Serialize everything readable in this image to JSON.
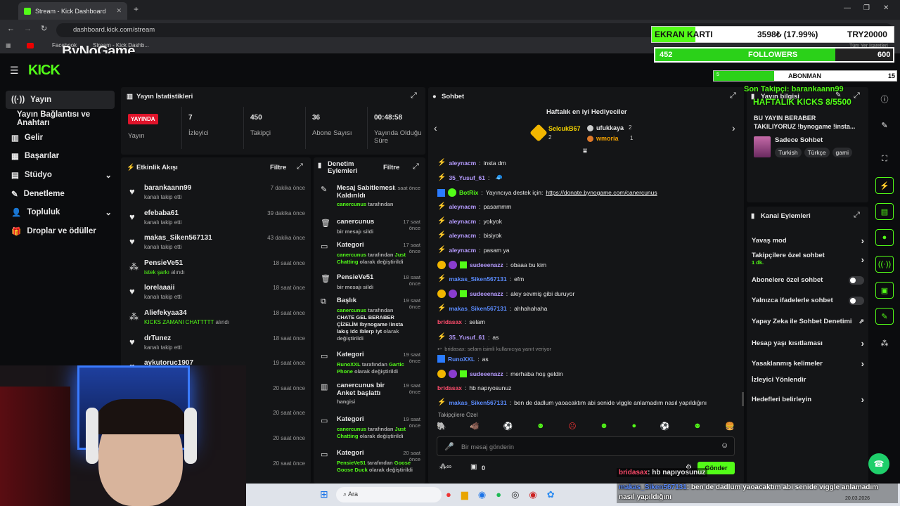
{
  "browser": {
    "tab_title": "Stream - Kick Dashboard",
    "url": "dashboard.kick.com/stream",
    "bookmarks": [
      "Facebook",
      "Stream - Kick Dashb..."
    ],
    "bookmarks_right": "Tüm Yer İşaretleri",
    "watermark": "ByNoGame"
  },
  "overlay": {
    "gpu_label": "EKRAN KARTI",
    "gpu_price": "3598₺ (17.99%)",
    "gpu_target": "TRY20000",
    "gpu_progress": 0.1799,
    "followers_current": "452",
    "followers_label": "FOLLOWERS",
    "followers_goal": "600",
    "followers_progress": 0.753,
    "subs_current": "5",
    "subs_label": "ABONMAN",
    "subs_goal": "15",
    "subs_progress": 0.333,
    "last_follower": "Son Takipçi: barankaann99",
    "weekly_kicks": "HAFTALIK KICKS 8/5500",
    "chat_overlay_1_user": "bridasax",
    "chat_overlay_1_msg": ": hb napıyosunuz",
    "chat_overlay_2_user": "makas_Siken567131",
    "chat_overlay_2_msg": ": ben de dadlum yaoacaktım abi senide viggle anlamadım nasıl yapıldığını"
  },
  "sidebar": {
    "items": [
      {
        "label": "Yayın",
        "icon": "broadcast-icon"
      },
      {
        "label": "Yayın Bağlantısı ve Anahtarı",
        "icon": ""
      },
      {
        "label": "Gelir",
        "icon": "revenue-icon"
      },
      {
        "label": "Başarılar",
        "icon": "achievements-icon"
      },
      {
        "label": "Stüdyo",
        "icon": "studio-icon"
      },
      {
        "label": "Denetleme",
        "icon": "wrench-icon"
      },
      {
        "label": "Topluluk",
        "icon": "community-icon"
      },
      {
        "label": "Droplar ve ödüller",
        "icon": "gift-icon"
      }
    ]
  },
  "stats": {
    "title": "Yayın İstatistikleri",
    "live": "YAYINDA",
    "live_label": "Yayın",
    "items": [
      {
        "value": "7",
        "label": "İzleyici"
      },
      {
        "value": "450",
        "label": "Takipçi"
      },
      {
        "value": "36",
        "label": "Abone Sayısı"
      },
      {
        "value": "00:48:58",
        "label": "Yayında Olduğu Süre"
      }
    ]
  },
  "activity": {
    "title": "Etkinlik Akışı",
    "filter": "Filtre",
    "events": [
      {
        "name": "barankaann99",
        "sub": "kanalı takip etti",
        "time": "7 dakika önce",
        "icon": "heart"
      },
      {
        "name": "efebaba61",
        "sub": "kanalı takip etti",
        "time": "39 dakika önce",
        "icon": "heart"
      },
      {
        "name": "makas_Siken567131",
        "sub": "kanalı takip etti",
        "time": "43 dakika önce",
        "icon": "heart"
      },
      {
        "name": "PensieVe51",
        "sub": "istek şarkı",
        "sub2": " alındı",
        "time": "18 saat önce",
        "icon": "points"
      },
      {
        "name": "lorelaaaii",
        "sub": "kanalı takip etti",
        "time": "18 saat önce",
        "icon": "heart"
      },
      {
        "name": "Aliefekyaa34",
        "sub": "KICKS ZAMANI CHATTTTT",
        "sub2": " alındı",
        "time": "18 saat önce",
        "icon": "points"
      },
      {
        "name": "drTunez",
        "sub": "kanalı takip etti",
        "time": "18 saat önce",
        "icon": "heart"
      },
      {
        "name": "aykutoruc1907",
        "sub": "",
        "time": "19 saat önce",
        "icon": "heart"
      },
      {
        "name": "",
        "sub": "",
        "time": "20 saat önce",
        "icon": ""
      },
      {
        "name": "",
        "sub": "",
        "time": "20 saat önce",
        "icon": ""
      },
      {
        "name": "",
        "sub": "",
        "time": "20 saat önce",
        "icon": ""
      },
      {
        "name": "",
        "sub": "",
        "time": "20 saat önce",
        "icon": ""
      }
    ]
  },
  "moderation": {
    "title": "Denetim Eylemleri",
    "filter": "Filtre",
    "actions": [
      {
        "title": "Mesaj Sabitlemesi Kaldırıldı",
        "time": "1 saat önce",
        "by": "canercunus",
        "by_suffix": " tarafından"
      },
      {
        "title": "canercunus",
        "time": "17 saat önce",
        "desc": "bir mesajı sildi"
      },
      {
        "title": "Kategori",
        "time": "17 saat önce",
        "by": "canercunus",
        "by_suffix": " tarafından ",
        "hl": "Just Chatting",
        "desc": " olarak değiştirildi"
      },
      {
        "title": "PensieVe51",
        "time": "18 saat önce",
        "desc": "bir mesajı sildi"
      },
      {
        "title": "Başlık",
        "time": "19 saat önce",
        "by": "canercunus",
        "by_suffix": " tarafından",
        "body": "CHATE GEL BERABER ÇİZELİM !bynogame !insta lakış !dc !blerp !yt",
        "desc": " olarak değiştirildi"
      },
      {
        "title": "Kategori",
        "time": "19 saat önce",
        "by": "RunoXXL",
        "by_suffix": " tarafından ",
        "hl": "Gartic Phone",
        "desc": " olarak değiştirildi"
      },
      {
        "title": "canercunus bir Anket başlattı",
        "time": "19 saat önce",
        "desc": "hangisi"
      },
      {
        "title": "Kategori",
        "time": "19 saat önce",
        "by": "canercunus",
        "by_suffix": " tarafından ",
        "hl": "Just Chatting",
        "desc": " olarak değiştirildi"
      },
      {
        "title": "Kategori",
        "time": "20 saat önce",
        "by": "PensieVe51",
        "by_suffix": " tarafından ",
        "hl": "Goose Goose Duck",
        "desc": " olarak değiştirildi"
      }
    ]
  },
  "chat": {
    "title": "Sohbet",
    "gifters_title": "Haftalık en iyi Hediyeciler",
    "gifters": [
      {
        "name": "SelcukB67",
        "count": "2"
      },
      {
        "name": "ufukkaya",
        "count": "2"
      },
      {
        "name": "wmoria",
        "count": "1"
      }
    ],
    "messages": [
      {
        "user": "aleynacm",
        "text": "insta dm",
        "color": "#b69cff"
      },
      {
        "user": "35_Yusuf_61",
        "text": "",
        "color": "#b69cff"
      },
      {
        "user": "BotRix",
        "text": "Yayıncıya destek için: ",
        "link": "https://donate.bynogame.com/canercunus",
        "color": "#53fc18"
      },
      {
        "user": "aleynacm",
        "text": "pasammm",
        "color": "#b69cff"
      },
      {
        "user": "aleynacm",
        "text": "yokyok",
        "color": "#b69cff"
      },
      {
        "user": "aleynacm",
        "text": "bisiyok",
        "color": "#b69cff"
      },
      {
        "user": "aleynacm",
        "text": "pasam ya",
        "color": "#b69cff"
      },
      {
        "user": "sudeeenazz",
        "text": "obaaa bu kim",
        "color": "#b69cff"
      },
      {
        "user": "makas_Siken567131",
        "text": "efm",
        "color": "#5b8cff"
      },
      {
        "user": "sudeeenazz",
        "text": "aley sevmiş gibi duruyor",
        "color": "#b69cff"
      },
      {
        "user": "makas_Siken567131",
        "text": "ahhahahaha",
        "color": "#5b8cff"
      },
      {
        "user": "bridasax",
        "text": "selam",
        "color": "#ff4d6d"
      },
      {
        "user": "35_Yusuf_61",
        "text": "as",
        "color": "#b69cff"
      },
      {
        "user": "RunoXXL",
        "text": "as",
        "color": "#5b8cff",
        "reply": "bridasax: selam isimli kullanıcıya yanıt veriyor"
      },
      {
        "user": "sudeeenazz",
        "text": "merhaba hoş geldin",
        "color": "#b69cff"
      },
      {
        "user": "bridasax",
        "text": "hb napıyosunuz",
        "color": "#ff4d6d"
      },
      {
        "user": "makas_Siken567131",
        "text": "ben de dadlum yaoacaktım abi senide viggle anlamadım nasıl yapıldığını",
        "color": "#5b8cff"
      }
    ],
    "followers_only": "Takipçilere Özel",
    "placeholder": "Bir mesaj gönderin",
    "points": "0",
    "send": "Gönder"
  },
  "stream_info": {
    "title": "Yayın bilgisi",
    "text": "BU YAYIN BERABER TAKILIYORUZ !bynogame !insta...",
    "chat_mode": "Sadece Sohbet",
    "tags": [
      "Turkish",
      "Türkçe",
      "gami"
    ]
  },
  "channel_actions": {
    "title": "Kanal Eylemleri",
    "items": [
      {
        "label": "Yavaş mod",
        "type": "arrow"
      },
      {
        "label": "Takipçilere özel sohbet",
        "sub": "1 dk.",
        "type": "arrow"
      },
      {
        "label": "Abonelere özel sohbet",
        "type": "toggle"
      },
      {
        "label": "Yalnızca ifadelerle sohbet",
        "type": "toggle"
      },
      {
        "label": "Yapay Zeka ile Sohbet Denetimi",
        "type": "external"
      },
      {
        "label": "Hesap yaşı kısıtlaması",
        "type": "arrow"
      },
      {
        "label": "Yasaklanmış kelimeler",
        "type": "arrow"
      },
      {
        "label": "İzleyici Yönlendir",
        "type": "none"
      },
      {
        "label": "Hedefleri belirleyin",
        "type": "arrow"
      }
    ]
  },
  "taskbar": {
    "search": "Ara",
    "time": "20.03.2026"
  },
  "colors": {
    "kick_green": "#53fc18",
    "live_red": "#e0142b"
  }
}
